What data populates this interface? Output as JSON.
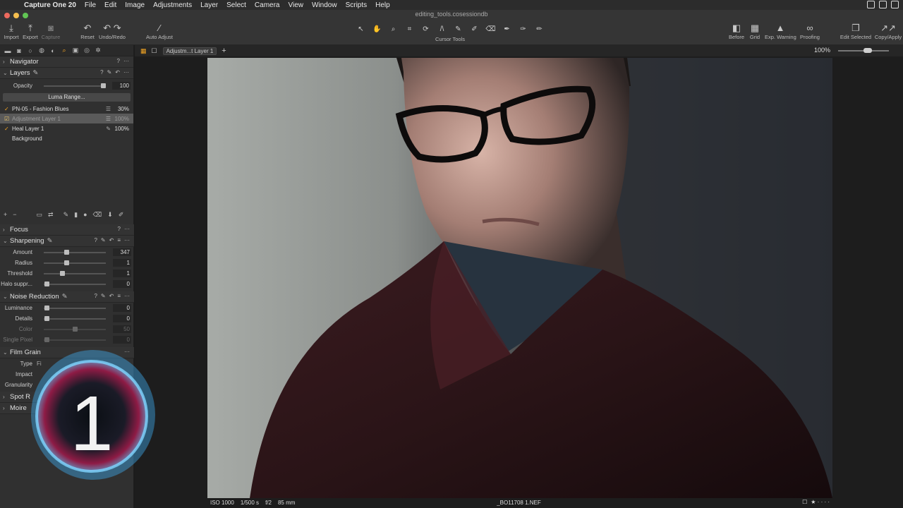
{
  "menubar": {
    "app": "Capture One 20",
    "items": [
      "File",
      "Edit",
      "Image",
      "Adjustments",
      "Layer",
      "Select",
      "Camera",
      "View",
      "Window",
      "Scripts",
      "Help"
    ]
  },
  "document": {
    "title": "editing_tools.cosessiondb"
  },
  "toolbar": {
    "left": [
      {
        "label": "Import",
        "icon": "import-icon"
      },
      {
        "label": "Export",
        "icon": "export-icon"
      },
      {
        "label": "Capture",
        "icon": "camera-icon"
      },
      {
        "label": "Reset",
        "icon": "reset-icon"
      },
      {
        "label": "Undo/Redo",
        "icon": "undo-redo-icon"
      },
      {
        "label": "Auto Adjust",
        "icon": "magic-wand-icon"
      }
    ],
    "cursor_tools_label": "Cursor Tools",
    "right": [
      {
        "label": "Before",
        "icon": "before-icon"
      },
      {
        "label": "Grid",
        "icon": "grid-icon"
      },
      {
        "label": "Exp. Warning",
        "icon": "warning-icon"
      },
      {
        "label": "Proofing",
        "icon": "glasses-icon"
      },
      {
        "label": "Edit Selected",
        "icon": "edit-selected-icon"
      },
      {
        "label": "Copy/Apply",
        "icon": "copy-apply-icon"
      }
    ]
  },
  "panel": {
    "navigator": "Navigator",
    "layers": {
      "title": "Layers",
      "opacity_label": "Opacity",
      "opacity_value": "100",
      "luma_button": "Luma Range...",
      "items": [
        {
          "name": "PN-05 - Fashion Blues",
          "percent": "30%"
        },
        {
          "name": "Adjustment Layer 1",
          "percent": "100%"
        },
        {
          "name": "Heal Layer 1",
          "percent": "100%"
        },
        {
          "name": "Background",
          "percent": ""
        }
      ]
    },
    "focus": "Focus",
    "sharpening": {
      "title": "Sharpening",
      "rows": [
        {
          "label": "Amount",
          "value": "347"
        },
        {
          "label": "Radius",
          "value": "1"
        },
        {
          "label": "Threshold",
          "value": "1"
        },
        {
          "label": "Halo suppr...",
          "value": "0"
        }
      ]
    },
    "noise_reduction": {
      "title": "Noise Reduction",
      "rows": [
        {
          "label": "Luminance",
          "value": "0"
        },
        {
          "label": "Details",
          "value": "0"
        },
        {
          "label": "Color",
          "value": "50"
        },
        {
          "label": "Single Pixel",
          "value": "0"
        }
      ]
    },
    "film_grain": {
      "title": "Film Grain",
      "type_label": "Type",
      "type_value": "Fi",
      "impact_label": "Impact",
      "granularity_label": "Granularity"
    },
    "spot_removal": "Spot R",
    "moire": "Moire"
  },
  "viewer": {
    "layer_select": "Adjustm...t Layer 1",
    "zoom": "100%"
  },
  "status": {
    "iso": "ISO 1000",
    "shutter": "1/500 s",
    "aperture": "f/2",
    "focal": "85 mm",
    "filename": "_BO11708 1.NEF",
    "rating": "★ · · · ·"
  },
  "logo_text": "1",
  "colors": {
    "accent": "#f5a623",
    "panel": "#303030",
    "toolbar": "#353535"
  }
}
